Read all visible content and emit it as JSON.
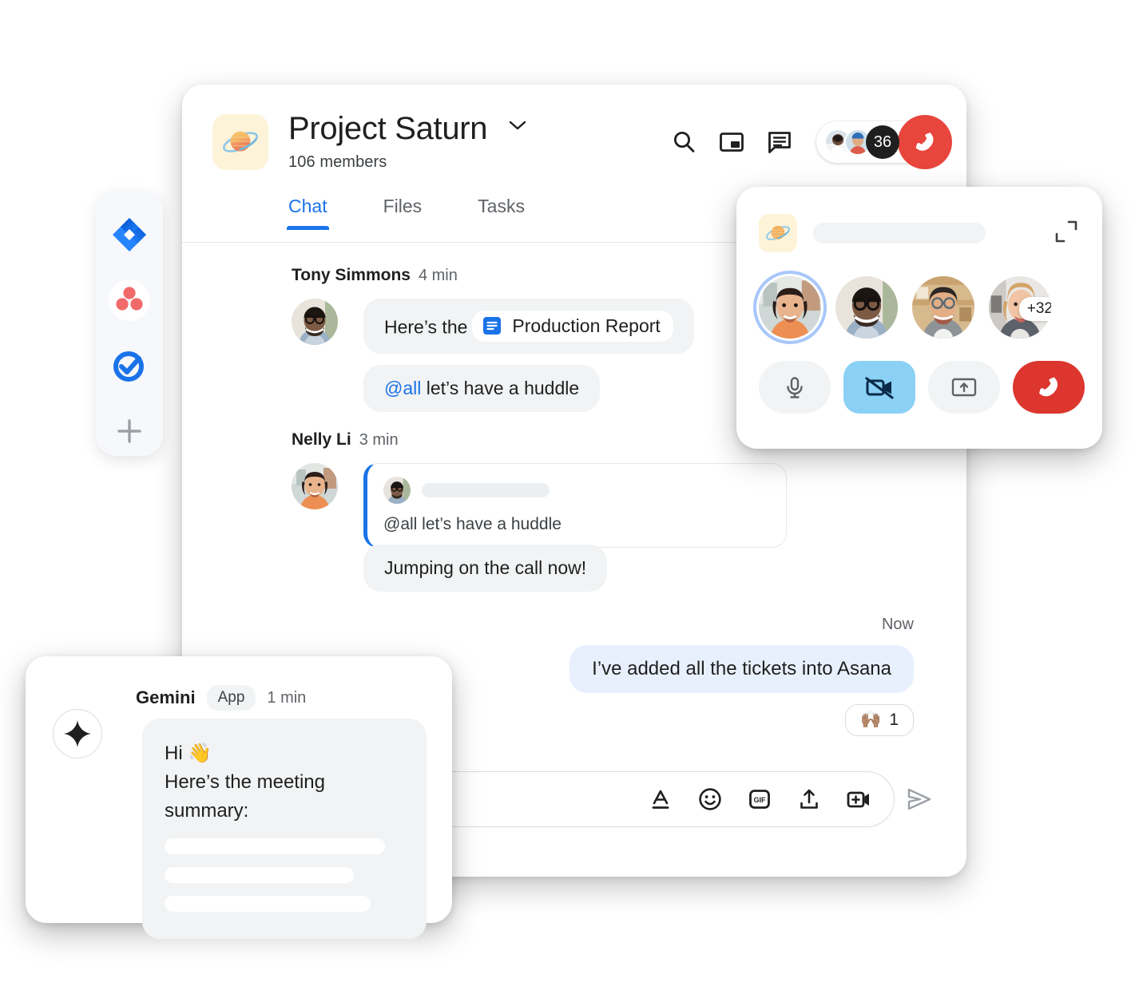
{
  "app_rail": {
    "items": [
      {
        "name": "jira-app",
        "label": "Jira",
        "icon": "jira-diamond-icon"
      },
      {
        "name": "asana-app",
        "label": "Asana",
        "icon": "asana-dots-icon"
      },
      {
        "name": "tasks-app",
        "label": "Tasks",
        "icon": "check-circle-icon"
      },
      {
        "name": "add-app",
        "label": "Add app",
        "icon": "plus-icon"
      }
    ]
  },
  "chat": {
    "space": {
      "title": "Project Saturn",
      "members": "106 members",
      "avatar_icon": "saturn-planet-icon",
      "chevron_icon": "chevron-down-icon"
    },
    "header_actions": [
      {
        "name": "search-button",
        "icon": "search-icon",
        "label": "Search"
      },
      {
        "name": "picture-in-picture-button",
        "icon": "picture-in-picture-icon",
        "label": "Picture in picture"
      },
      {
        "name": "chat-panel-button",
        "icon": "chat-bubble-icon",
        "label": "Chat"
      }
    ],
    "call_chip": {
      "participant_count": "36",
      "hangup_icon": "hangup-phone-icon",
      "hangup_color": "#e8453c"
    },
    "tabs": [
      {
        "label": "Chat",
        "active": true
      },
      {
        "label": "Files",
        "active": false
      },
      {
        "label": "Tasks",
        "active": false
      }
    ],
    "messages": [
      {
        "author": "Tony Simmons",
        "time": "4 min",
        "bubbles": [
          {
            "type": "doc-chip",
            "prefix": "Here’s the",
            "chip_label": "Production Report",
            "chip_icon": "google-docs-icon"
          },
          {
            "type": "mention",
            "mention": "@all",
            "text": " let’s have a huddle"
          }
        ]
      },
      {
        "author": "Nelly Li",
        "time": "3 min",
        "quote": {
          "text": "@all let’s have a huddle",
          "accent_color": "#1a73e8"
        },
        "bubbles": [
          {
            "type": "text",
            "text": "Jumping on the call now!"
          }
        ]
      }
    ],
    "outgoing": {
      "time": "Now",
      "text": "I’ve added all the tickets into Asana",
      "bubble_color": "#e8f0fe",
      "reaction": {
        "emoji": "🙌🏽",
        "count": "1"
      }
    },
    "composer": {
      "placeholder": "",
      "actions": [
        {
          "name": "format-text-button",
          "icon": "format-text-icon",
          "label": "Format"
        },
        {
          "name": "emoji-button",
          "icon": "emoji-smiley-icon",
          "label": "Emoji"
        },
        {
          "name": "gif-button",
          "icon": "gif-icon",
          "label": "GIF"
        },
        {
          "name": "upload-file-button",
          "icon": "upload-icon",
          "label": "Upload file"
        },
        {
          "name": "add-video-meeting-button",
          "icon": "add-video-icon",
          "label": "Add video meeting"
        }
      ],
      "send": {
        "name": "send-button",
        "icon": "send-arrow-icon",
        "label": "Send"
      }
    }
  },
  "call_card": {
    "avatar_icon": "saturn-planet-icon",
    "expand_icon": "expand-icon",
    "overflow_count": "+32",
    "participants": [
      {
        "name": "participant-1",
        "speaking": true
      },
      {
        "name": "participant-2",
        "speaking": false
      },
      {
        "name": "participant-3",
        "speaking": false
      },
      {
        "name": "participant-4",
        "speaking": false
      }
    ],
    "controls": [
      {
        "name": "microphone-button",
        "icon": "microphone-icon",
        "state": "on",
        "color": "#f1f3f4"
      },
      {
        "name": "camera-button",
        "icon": "camera-off-icon",
        "state": "off",
        "color": "#8ad1f5"
      },
      {
        "name": "present-screen-button",
        "icon": "present-screen-icon",
        "state": "off",
        "color": "#f1f3f4"
      },
      {
        "name": "leave-call-button",
        "icon": "hangup-phone-icon",
        "state": "",
        "color": "#dc362e"
      }
    ]
  },
  "gemini_card": {
    "name": "Gemini",
    "badge": "App",
    "time": "1 min",
    "avatar_icon": "gemini-sparkle-icon",
    "line1": "Hi 👋",
    "line2": "Here’s the meeting summary:",
    "skeleton_widths": [
      "92%",
      "79%",
      "86%"
    ]
  }
}
